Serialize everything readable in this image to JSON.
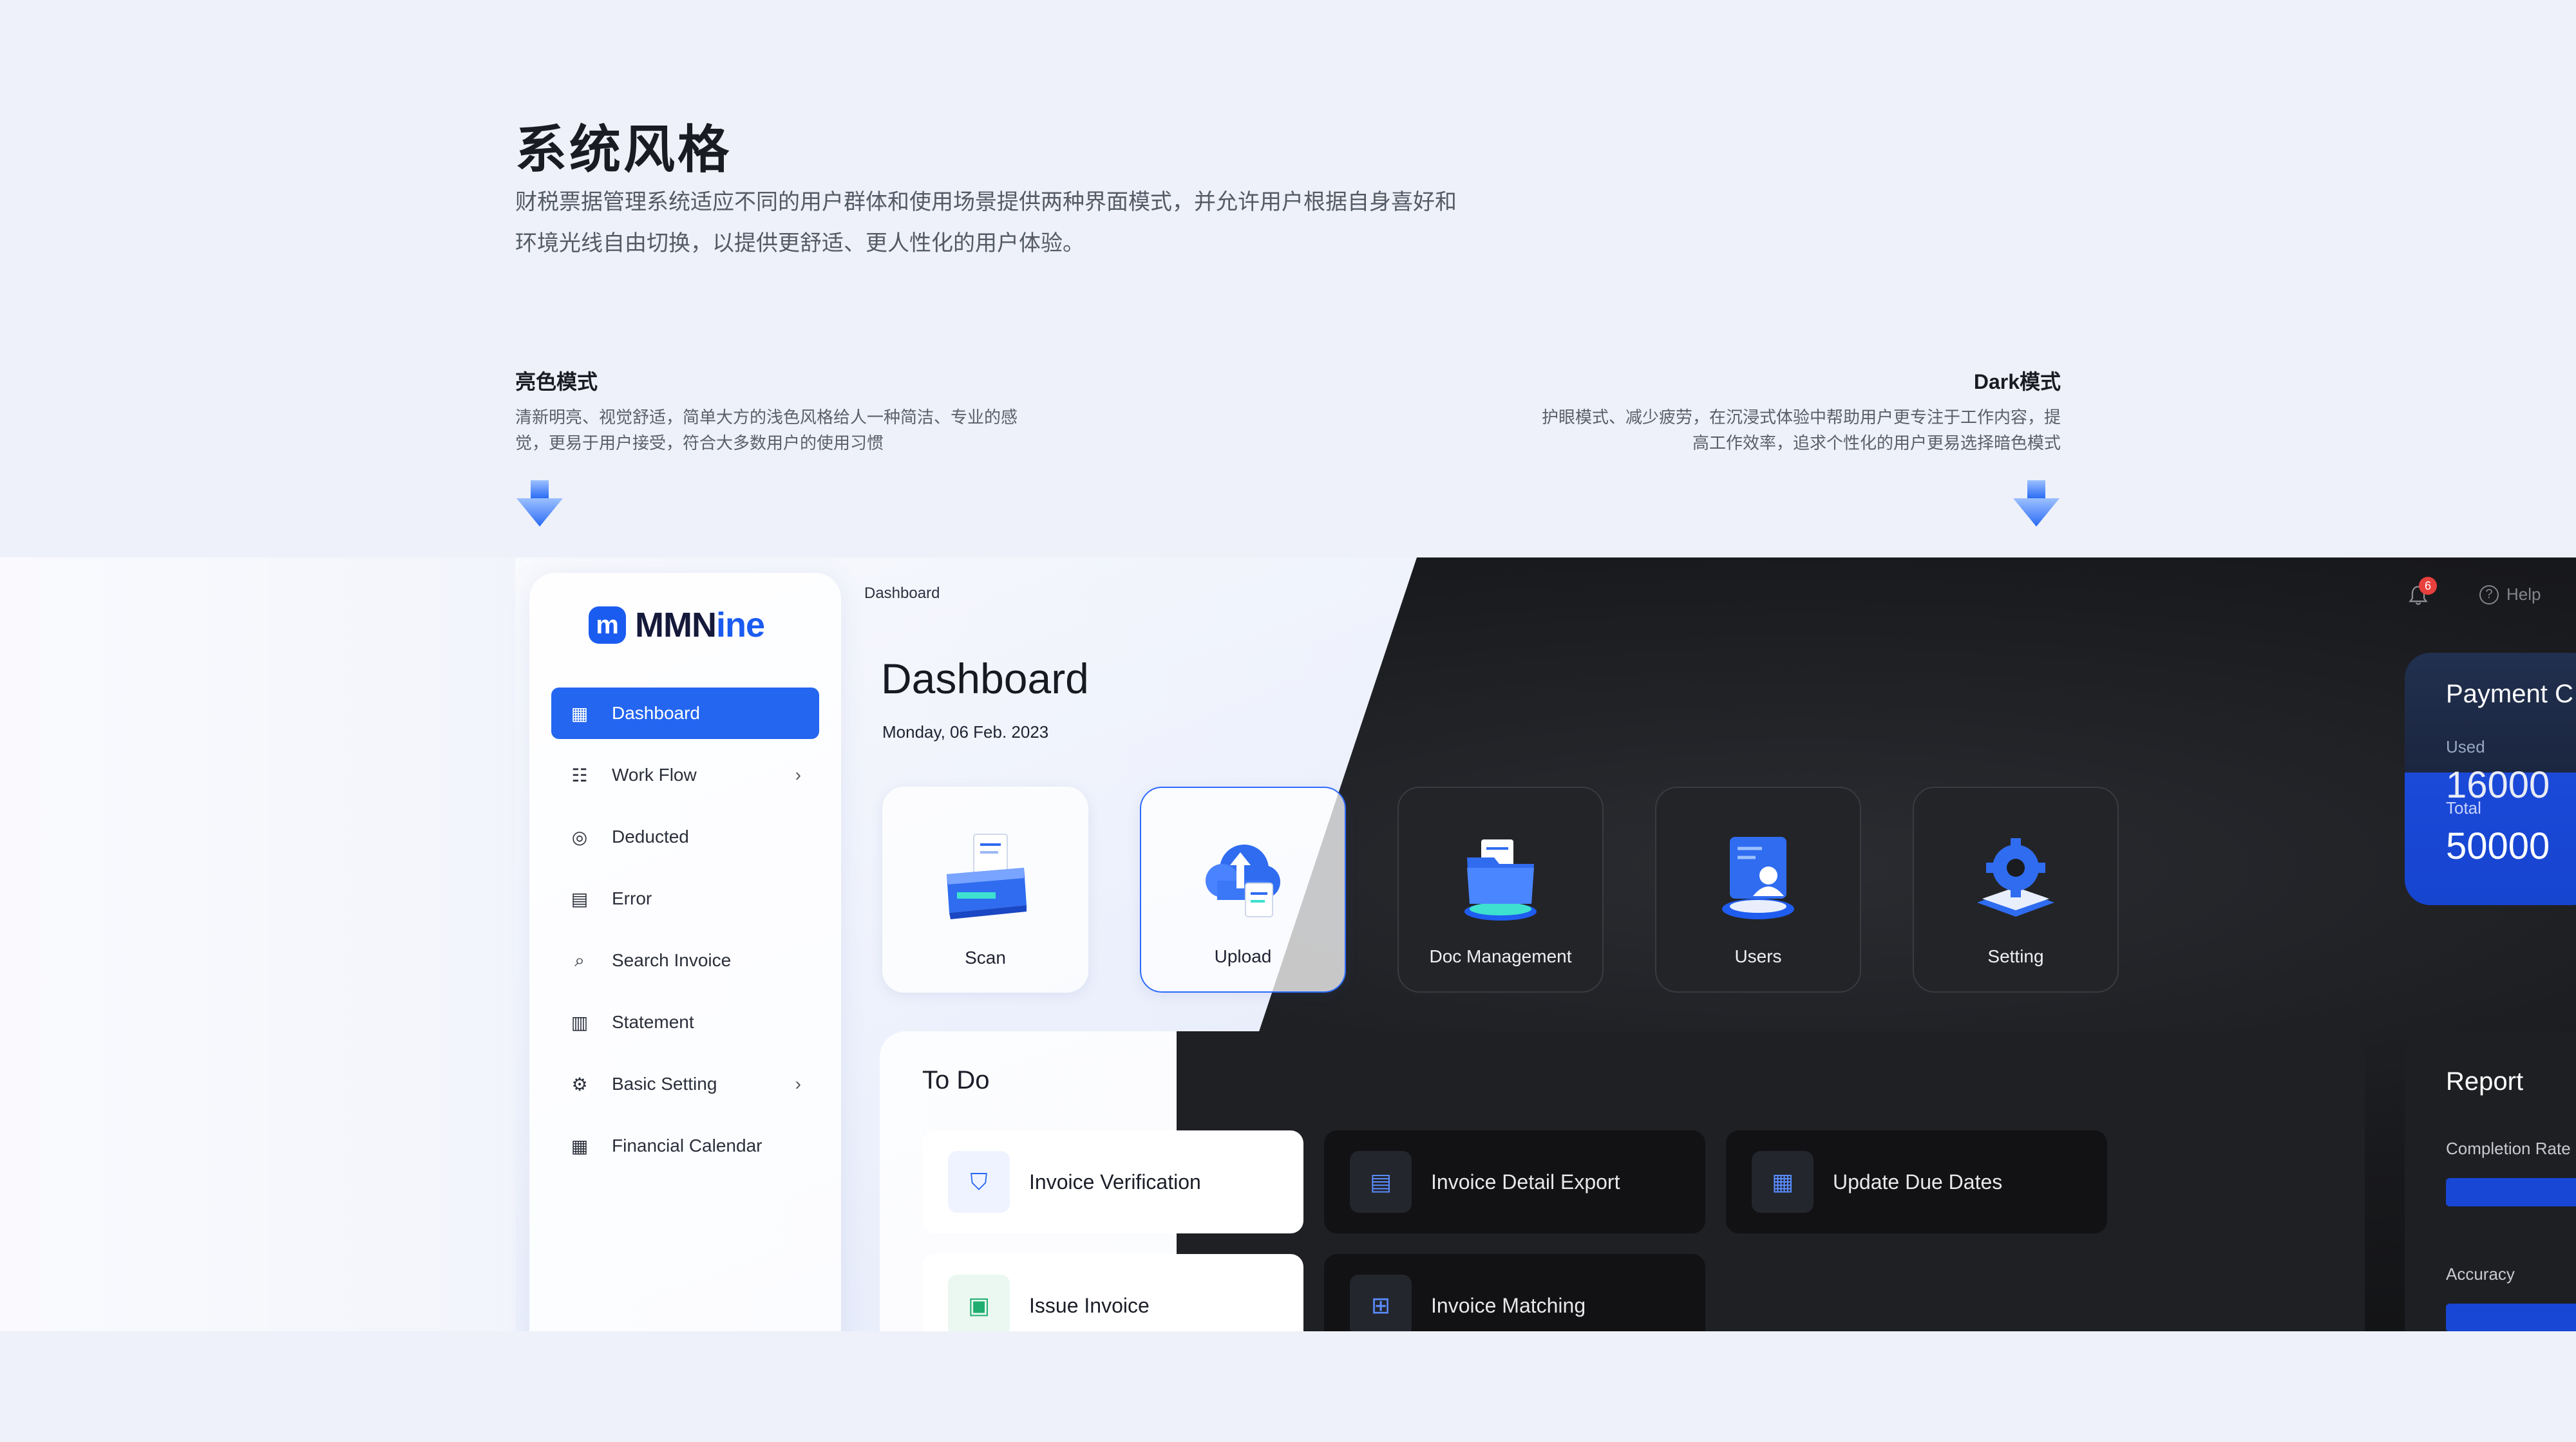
{
  "header": {
    "title": "系统风格",
    "desc_line1": "财税票据管理系统适应不同的用户群体和使用场景提供两种界面模式，并允许用户根据自身喜好和",
    "desc_line2": "环境光线自由切换，以提供更舒适、更人性化的用户体验。"
  },
  "modes": {
    "light": {
      "title": "亮色模式",
      "desc_line1": "清新明亮、视觉舒适，简单大方的浅色风格给人一种简洁、专业的感",
      "desc_line2": "觉，更易于用户接受，符合大多数用户的使用习惯"
    },
    "dark": {
      "title": "Dark模式",
      "desc_line1": "护眼模式、减少疲劳，在沉浸式体验中帮助用户更专注于工作内容，提",
      "desc_line2": "高工作效率，追求个性化的用户更易选择暗色模式"
    }
  },
  "app": {
    "logo_text_dark": "MMN",
    "logo_text_blue": "ine",
    "breadcrumb": "Dashboard",
    "page_title": "Dashboard",
    "date": "Monday, 06 Feb. 2023",
    "notification_count": "6",
    "help_label": "Help",
    "accent": "#2466f0"
  },
  "sidebar": {
    "items": [
      {
        "label": "Dashboard",
        "icon": "grid-icon"
      },
      {
        "label": "Work Flow",
        "icon": "workflow-icon"
      },
      {
        "label": "Deducted",
        "icon": "coin-icon"
      },
      {
        "label": "Error",
        "icon": "error-doc-icon"
      },
      {
        "label": "Search Invoice",
        "icon": "search-doc-icon"
      },
      {
        "label": "Statement",
        "icon": "statement-icon"
      },
      {
        "label": "Basic Setting",
        "icon": "gear-icon"
      },
      {
        "label": "Financial Calendar",
        "icon": "calendar-grid-icon"
      }
    ]
  },
  "tiles": [
    {
      "label": "Scan",
      "icon": "scanner-icon"
    },
    {
      "label": "Upload",
      "icon": "cloud-upload-icon"
    },
    {
      "label": "Doc Management",
      "icon": "folder-icon"
    },
    {
      "label": "Users",
      "icon": "user-card-icon"
    },
    {
      "label": "Setting",
      "icon": "gear-3d-icon"
    }
  ],
  "todo": {
    "title": "To Do",
    "items": [
      {
        "label": "Invoice Verification",
        "icon": "shield-icon"
      },
      {
        "label": "Invoice Detail Export",
        "icon": "doc-export-icon"
      },
      {
        "label": "Update Due Dates",
        "icon": "calendar-icon"
      },
      {
        "label": "Issue Invoice",
        "icon": "issue-icon"
      },
      {
        "label": "Invoice Matching",
        "icon": "match-icon"
      }
    ]
  },
  "payment": {
    "title": "Payment C",
    "used_label": "Used",
    "used_value": "16000",
    "total_label": "Total",
    "total_value": "50000"
  },
  "report": {
    "title": "Report",
    "completion_label": "Completion Rate",
    "accuracy_label": "Accuracy"
  }
}
